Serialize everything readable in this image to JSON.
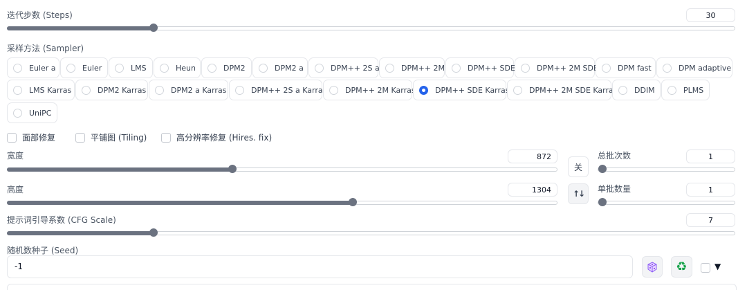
{
  "steps": {
    "label": "迭代步数 (Steps)",
    "value": "30",
    "fraction": 0.2
  },
  "sampler": {
    "label": "采样方法 (Sampler)",
    "options": [
      "Euler a",
      "Euler",
      "LMS",
      "Heun",
      "DPM2",
      "DPM2 a",
      "DPM++ 2S a",
      "DPM++ 2M",
      "DPM++ SDE",
      "DPM++ 2M SDE",
      "DPM fast",
      "DPM adaptive",
      "LMS Karras",
      "DPM2 Karras",
      "DPM2 a Karras",
      "DPM++ 2S a Karras",
      "DPM++ 2M Karras",
      "DPM++ SDE Karras",
      "DPM++ 2M SDE Karras",
      "DDIM",
      "PLMS",
      "UniPC"
    ],
    "selected": "DPM++ SDE Karras"
  },
  "checks": {
    "restore_faces": "面部修复",
    "tiling": "平铺图 (Tiling)",
    "hires": "高分辨率修复 (Hires. fix)"
  },
  "width": {
    "label": "宽度",
    "value": "872",
    "fraction": 0.408
  },
  "height": {
    "label": "高度",
    "value": "1304",
    "fraction": 0.627
  },
  "batch_count": {
    "label": "总批次数",
    "value": "1",
    "fraction": 0
  },
  "batch_size": {
    "label": "单批数量",
    "value": "1",
    "fraction": 0
  },
  "close_button": "关",
  "swap_icon": "swap-vertical-icon",
  "cfg": {
    "label": "提示词引导系数 (CFG Scale)",
    "value": "7",
    "fraction": 0.2
  },
  "seed": {
    "label": "随机数种子 (Seed)",
    "value": "-1"
  },
  "dice_icon": "dice-icon",
  "recycle_icon": "recycle-icon",
  "extra_toggle": "▼",
  "colors": {
    "accent": "#2563eb",
    "slider": "#6b7280"
  }
}
